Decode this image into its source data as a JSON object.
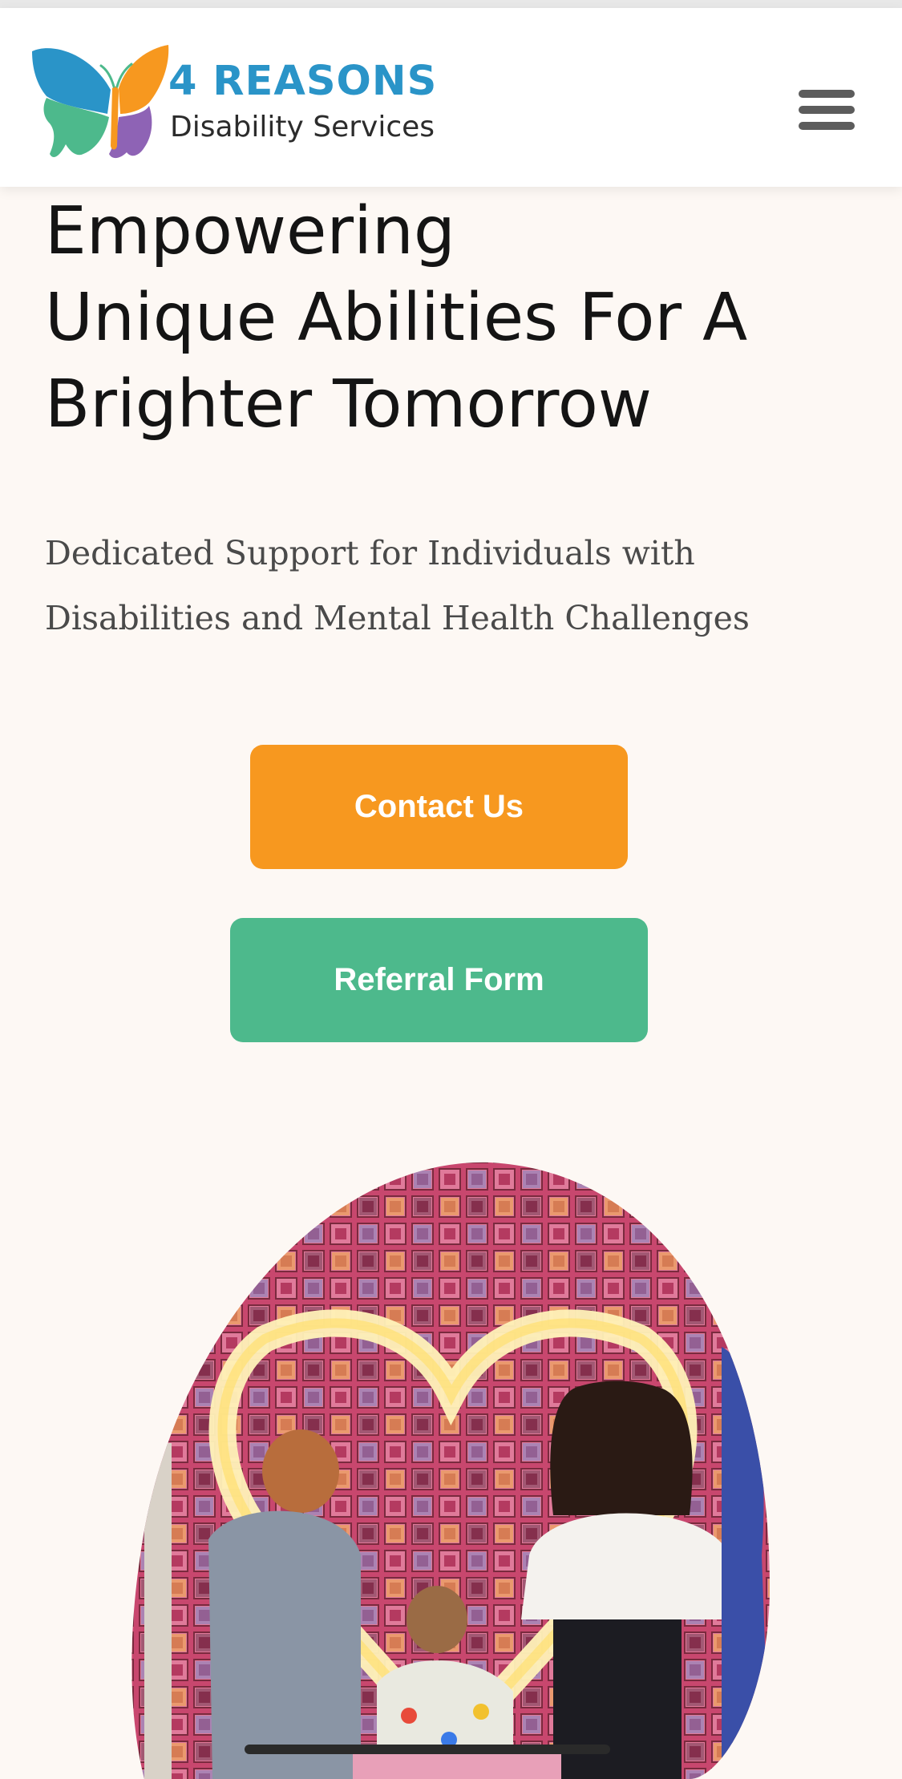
{
  "header": {
    "logo": {
      "title": "4 REASONS",
      "subtitle": "Disability Services",
      "icon": "butterfly-logo-icon",
      "colors": [
        "#2a94c8",
        "#f7981f",
        "#4db98c",
        "#8e63b5"
      ]
    },
    "menu_icon": "hamburger-menu-icon"
  },
  "hero": {
    "title_lines": [
      "Empowering",
      "Unique Abilities For A",
      "Brighter Tomorrow"
    ],
    "subtitle_lines": [
      "Dedicated Support for Individuals with",
      "Disabilities and Mental Health Challenges"
    ]
  },
  "buttons": {
    "contact": "Contact Us",
    "referral": "Referral Form"
  },
  "colors": {
    "background": "#fdf8f4",
    "contact_button": "#f7981f",
    "referral_button": "#4db98c",
    "brand_blue": "#2a94c8"
  }
}
